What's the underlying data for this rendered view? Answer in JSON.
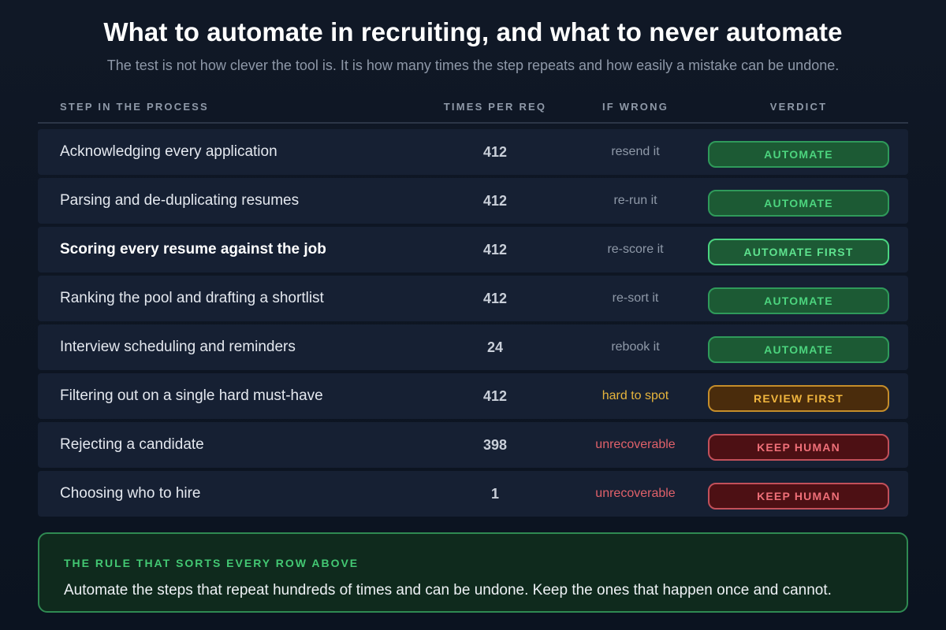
{
  "title": "What to automate in recruiting, and what to never automate",
  "subtitle": "The test is not how clever the tool is. It is how many times the step repeats and how easily a mistake can be undone.",
  "headers": {
    "step": "STEP IN THE PROCESS",
    "times": "TIMES PER REQ",
    "wrong": "IF WRONG",
    "verdict": "VERDICT"
  },
  "rows": [
    {
      "step": "Acknowledging every application",
      "times": "412",
      "wrong": "resend it",
      "verdict": "AUTOMATE"
    },
    {
      "step": "Parsing and de-duplicating resumes",
      "times": "412",
      "wrong": "re-run it",
      "verdict": "AUTOMATE"
    },
    {
      "step": "Scoring every resume against the job",
      "times": "412",
      "wrong": "re-score it",
      "verdict": "AUTOMATE FIRST"
    },
    {
      "step": "Ranking the pool and drafting a shortlist",
      "times": "412",
      "wrong": "re-sort it",
      "verdict": "AUTOMATE"
    },
    {
      "step": "Interview scheduling and reminders",
      "times": "24",
      "wrong": "rebook it",
      "verdict": "AUTOMATE"
    },
    {
      "step": "Filtering out on a single hard must-have",
      "times": "412",
      "wrong": "hard to spot",
      "verdict": "REVIEW FIRST"
    },
    {
      "step": "Rejecting a candidate",
      "times": "398",
      "wrong": "unrecoverable",
      "verdict": "KEEP HUMAN"
    },
    {
      "step": "Choosing who to hire",
      "times": "1",
      "wrong": "unrecoverable",
      "verdict": "KEEP HUMAN"
    }
  ],
  "rule": {
    "label": "THE RULE THAT SORTS EVERY ROW ABOVE",
    "text": "Automate the steps that repeat hundreds of times and can be undone. Keep the ones that happen once and cannot."
  },
  "colors": {
    "automate": "#4cd47e",
    "review": "#f0b53e",
    "keep_human": "#ef6f78",
    "row_bg": "#162033"
  }
}
